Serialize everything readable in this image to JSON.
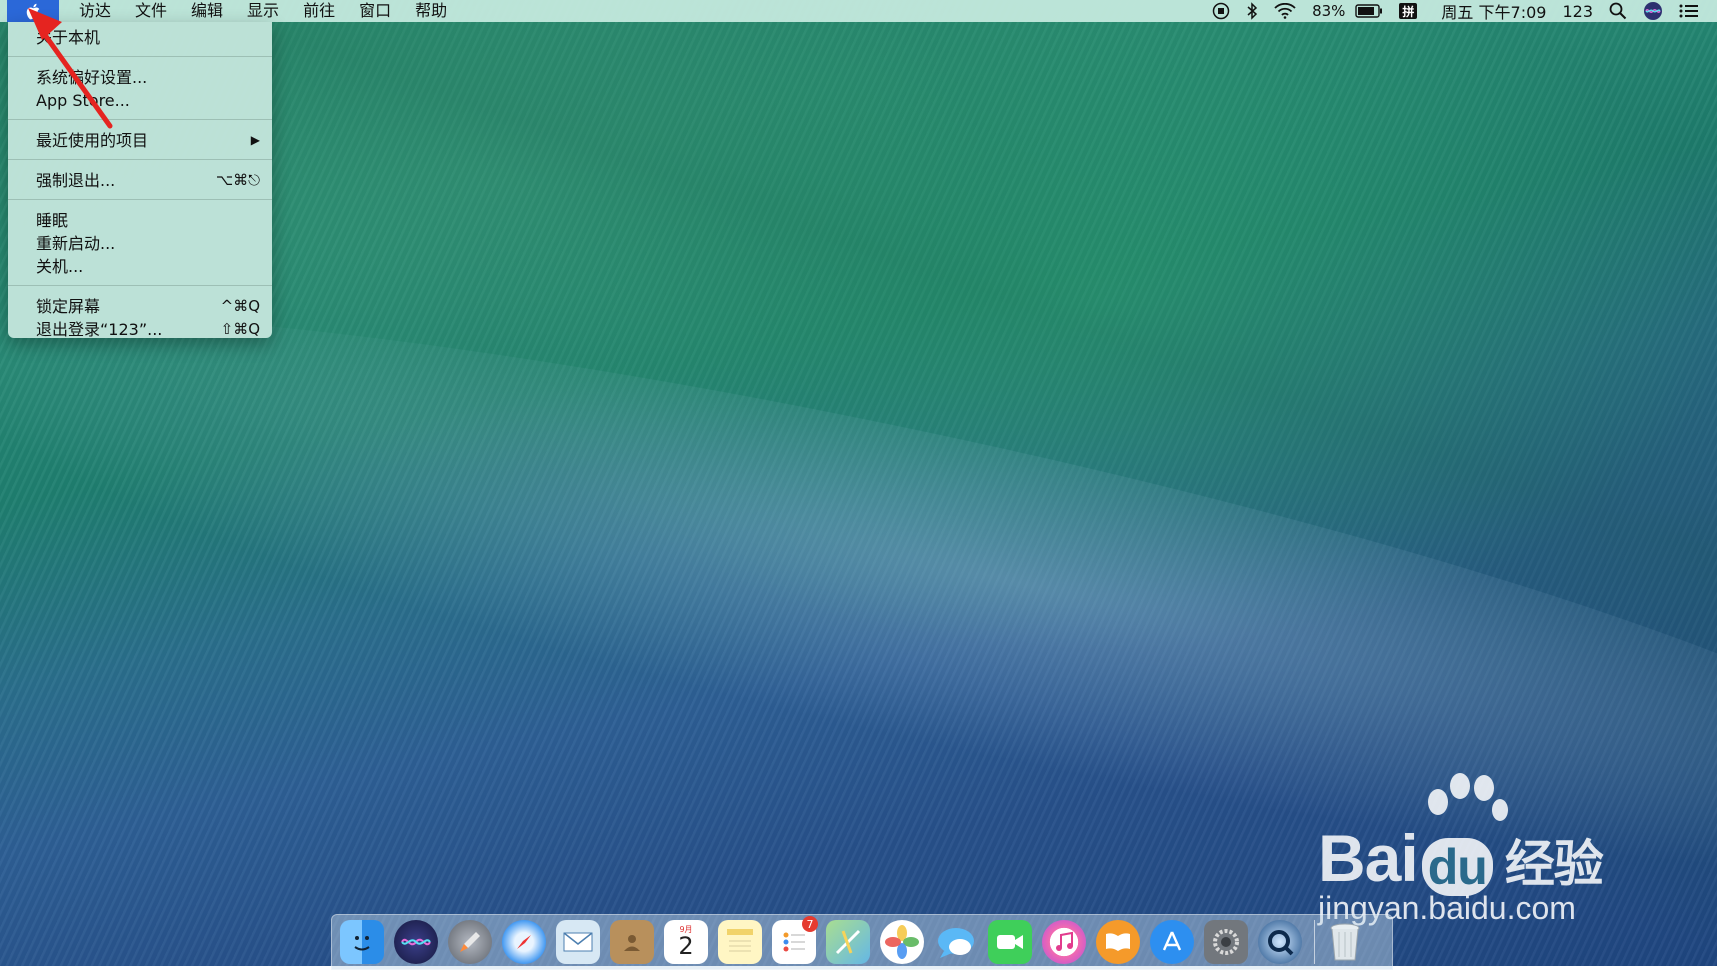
{
  "menubar": {
    "apple_icon": "apple-icon",
    "items": [
      "访达",
      "文件",
      "编辑",
      "显示",
      "前往",
      "窗口",
      "帮助"
    ],
    "status": {
      "battery_percent": "83%",
      "input_method": "拼",
      "datetime": "周五 下午7:09",
      "user": "123",
      "icons": [
        "screen-record-icon",
        "bluetooth-icon",
        "wifi-icon",
        "battery-icon",
        "spotlight-icon",
        "siri-icon",
        "notification-center-icon"
      ]
    }
  },
  "apple_menu": {
    "groups": [
      [
        {
          "label": "关于本机",
          "shortcut": ""
        }
      ],
      [
        {
          "label": "系统偏好设置...",
          "shortcut": ""
        },
        {
          "label": "App Store...",
          "shortcut": ""
        }
      ],
      [
        {
          "label": "最近使用的项目",
          "shortcut": "▶"
        }
      ],
      [
        {
          "label": "强制退出...",
          "shortcut": "⌥⌘⎋"
        }
      ],
      [
        {
          "label": "睡眠",
          "shortcut": ""
        },
        {
          "label": "重新启动...",
          "shortcut": ""
        },
        {
          "label": "关机...",
          "shortcut": ""
        }
      ],
      [
        {
          "label": "锁定屏幕",
          "shortcut": "^⌘Q"
        },
        {
          "label": "退出登录“123”...",
          "shortcut": "⇧⌘Q"
        }
      ]
    ]
  },
  "dock": {
    "apps": [
      {
        "name": "finder",
        "color": "#3aa0f0"
      },
      {
        "name": "siri",
        "color": "#2b2f6a"
      },
      {
        "name": "launchpad",
        "color": "#8a8f99"
      },
      {
        "name": "safari",
        "color": "#2f8ef0"
      },
      {
        "name": "mail",
        "color": "#cfe3f2"
      },
      {
        "name": "contacts",
        "color": "#b08b5a"
      },
      {
        "name": "calendar",
        "color": "#ffffff",
        "month": "9月",
        "day": "2"
      },
      {
        "name": "notes",
        "color": "#fff6c8"
      },
      {
        "name": "reminders",
        "color": "#ffffff",
        "badge": "7"
      },
      {
        "name": "maps",
        "color": "#8ed27a"
      },
      {
        "name": "photos",
        "color": "#ffffff"
      },
      {
        "name": "messages",
        "color": "#5ab8f6"
      },
      {
        "name": "facetime",
        "color": "#3fcf5a"
      },
      {
        "name": "itunes",
        "color": "#f26ab0"
      },
      {
        "name": "ibooks",
        "color": "#f59a2a"
      },
      {
        "name": "app-store",
        "color": "#2d8ff0"
      },
      {
        "name": "system-preferences",
        "color": "#6f7479"
      },
      {
        "name": "quicktime",
        "color": "#1e4f86"
      }
    ],
    "trash": {
      "name": "trash",
      "color": "#dfe6ea"
    }
  },
  "watermark": {
    "logo_text_1": "Bai",
    "logo_text_du": "du",
    "logo_text_2": "经验",
    "url": "jingyan.baidu.com"
  }
}
